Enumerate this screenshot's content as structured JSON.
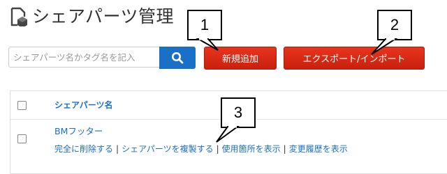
{
  "header": {
    "title": "シェアパーツ管理"
  },
  "search": {
    "placeholder": "シェアパーツ名かタグ名を記入"
  },
  "toolbar": {
    "add_label": "新規追加",
    "export_label": "エクスポート/インポート"
  },
  "table": {
    "column_header": "シェアパーツ名",
    "rows": [
      {
        "name": "BMフッター",
        "actions": [
          "完全に削除する",
          "シェアパーツを複製する",
          "使用箇所を表示",
          "変更履歴を表示"
        ]
      }
    ]
  },
  "callouts": [
    "1",
    "2",
    "3"
  ],
  "colors": {
    "accent_blue": "#1a6fc7",
    "button_red": "#d9290f"
  }
}
